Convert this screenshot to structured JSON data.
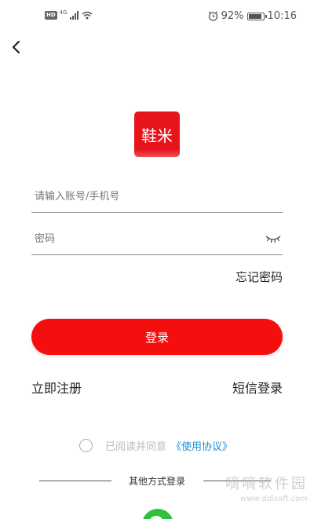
{
  "status_bar": {
    "network_badge": "HD",
    "network_type": "4G",
    "battery_percent": "92%",
    "battery_level": 0.92,
    "time": "10:16"
  },
  "logo": {
    "text": "鞋米",
    "color": "#e8141c"
  },
  "account_field": {
    "placeholder": "请输入账号/手机号",
    "value": ""
  },
  "password_field": {
    "placeholder": "密码",
    "value": ""
  },
  "forgot_password": "忘记密码",
  "login_button": {
    "label": "登录",
    "color": "#f50e0e"
  },
  "register_link": "立即注册",
  "sms_login_link": "短信登录",
  "agreement": {
    "text": "已阅读并同意",
    "link": "《使用协议》",
    "checked": false,
    "link_color": "#1a8ed4"
  },
  "other_login": {
    "label": "其他方式登录",
    "wechat_color": "#2ec13a"
  },
  "watermark": {
    "main": "嘀嘀软件园",
    "sub": "www.ddisoft.com"
  }
}
